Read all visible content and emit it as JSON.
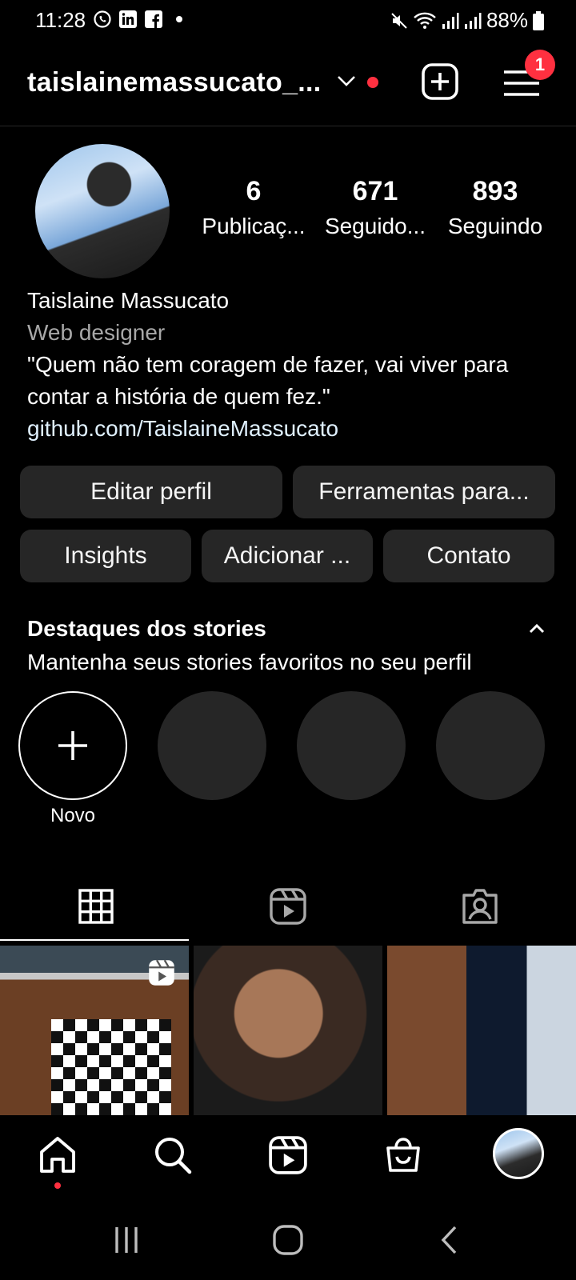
{
  "status_bar": {
    "time": "11:28",
    "battery": "88%",
    "app_icons": [
      "whatsapp-icon",
      "linkedin-icon",
      "facebook-icon"
    ]
  },
  "header": {
    "username": "taislainemassucato_...",
    "notification_count": "1"
  },
  "profile": {
    "stats": [
      {
        "count": "6",
        "label": "Publicaç..."
      },
      {
        "count": "671",
        "label": "Seguido..."
      },
      {
        "count": "893",
        "label": "Seguindo"
      }
    ],
    "name": "Taislaine Massucato",
    "category": "Web designer",
    "bio": "\"Quem não tem coragem de fazer, vai viver para contar a história de quem fez.\"",
    "link": "github.com/TaislaineMassucato"
  },
  "actions": {
    "edit_profile": "Editar perfil",
    "tools": "Ferramentas para...",
    "insights": "Insights",
    "add": "Adicionar ...",
    "contact": "Contato"
  },
  "highlights": {
    "title": "Destaques dos stories",
    "subtitle": "Mantenha seus stories favoritos no seu perfil",
    "new_label": "Novo"
  },
  "tabs": [
    "grid-icon",
    "reels-icon",
    "tagged-icon"
  ],
  "bottom_nav": [
    "home-icon",
    "search-icon",
    "reels-icon",
    "shop-icon",
    "profile-avatar"
  ],
  "colors": {
    "background": "#000000",
    "button_bg": "#262626",
    "accent_red": "#ff3040",
    "secondary_text": "#a8a8a8"
  }
}
